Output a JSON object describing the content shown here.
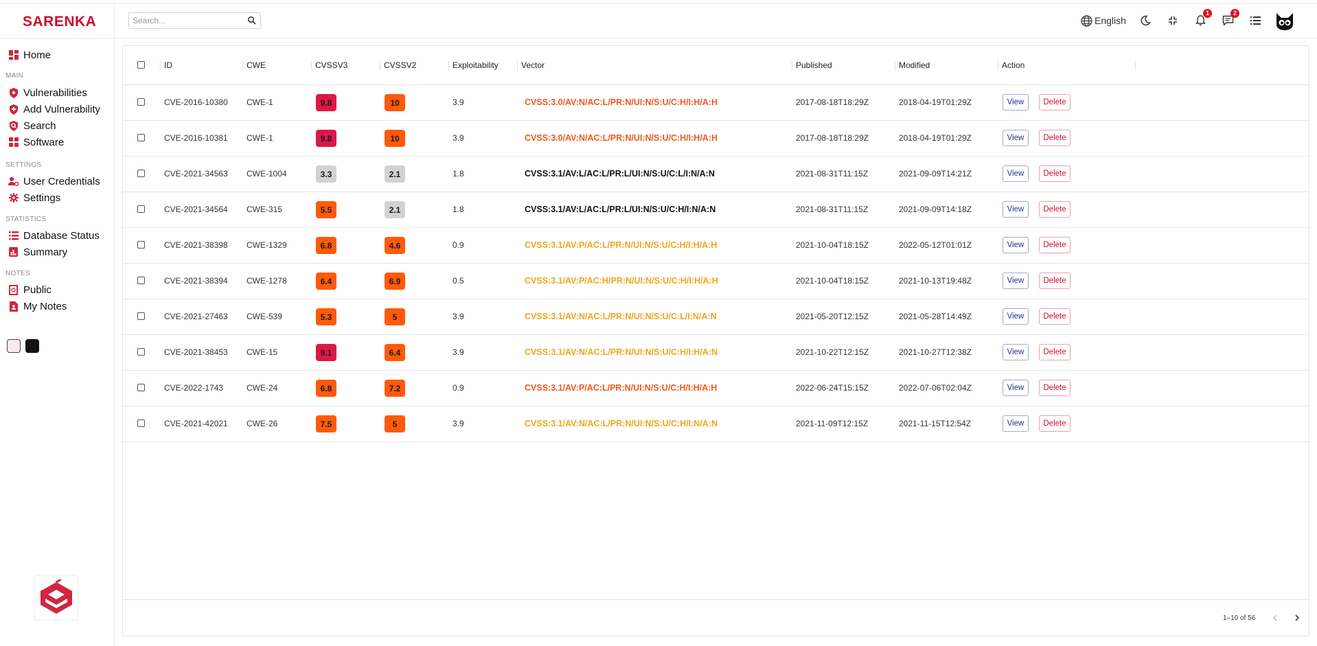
{
  "app": {
    "brand": "SARENKA"
  },
  "sidebar": {
    "home": "Home",
    "sections": {
      "main": "MAIN",
      "settings": "SETTINGS",
      "statistics": "STATISTICS",
      "notes": "NOTES"
    },
    "main_items": [
      "Vulnerabilities",
      "Add Vulnerability",
      "Search",
      "Software"
    ],
    "settings_items": [
      "User Credentials",
      "Settings"
    ],
    "statistics_items": [
      "Database Status",
      "Summary"
    ],
    "notes_items": [
      "Public",
      "My Notes"
    ],
    "theme_swatches": [
      "#f8e9ec",
      "#111111"
    ]
  },
  "header": {
    "search_placeholder": "Search...",
    "language": "English",
    "notifications_count": "1",
    "messages_count": "2"
  },
  "table": {
    "columns": [
      "ID",
      "CWE",
      "CVSSV3",
      "CVSSV2",
      "Exploitability",
      "Vector",
      "Published",
      "Modified",
      "Action"
    ],
    "view_label": "View",
    "delete_label": "Delete",
    "rows": [
      {
        "id": "CVE-2016-10380",
        "cwe": "CWE-1",
        "cvss3": "9.8",
        "cvss3_color": "#dc1848",
        "cvss2": "10",
        "cvss2_color": "#ff5a0a",
        "exploitability": "3.9",
        "vector": "CVSS:3.0/AV:N/AC:L/PR:N/UI:N/S:U/C:H/I:H/A:H",
        "vector_color": "#f0581f",
        "published": "2017-08-18T18:29Z",
        "modified": "2018-04-19T01:29Z"
      },
      {
        "id": "CVE-2016-10381",
        "cwe": "CWE-1",
        "cvss3": "9.8",
        "cvss3_color": "#dc1848",
        "cvss2": "10",
        "cvss2_color": "#ff5a0a",
        "exploitability": "3.9",
        "vector": "CVSS:3.0/AV:N/AC:L/PR:N/UI:N/S:U/C:H/I:H/A:H",
        "vector_color": "#f0581f",
        "published": "2017-08-18T18:29Z",
        "modified": "2018-04-19T01:29Z"
      },
      {
        "id": "CVE-2021-34563",
        "cwe": "CWE-1004",
        "cvss3": "3.3",
        "cvss3_color": "#d2d2d2",
        "cvss2": "2.1",
        "cvss2_color": "#d2d2d2",
        "exploitability": "1.8",
        "vector": "CVSS:3.1/AV:L/AC:L/PR:L/UI:N/S:U/C:L/I:N/A:N",
        "vector_color": "#111111",
        "published": "2021-08-31T11:15Z",
        "modified": "2021-09-09T14:21Z"
      },
      {
        "id": "CVE-2021-34564",
        "cwe": "CWE-315",
        "cvss3": "5.5",
        "cvss3_color": "#ff5a0a",
        "cvss2": "2.1",
        "cvss2_color": "#d2d2d2",
        "exploitability": "1.8",
        "vector": "CVSS:3.1/AV:L/AC:L/PR:L/UI:N/S:U/C:H/I:N/A:N",
        "vector_color": "#111111",
        "published": "2021-08-31T11:15Z",
        "modified": "2021-09-09T14:18Z"
      },
      {
        "id": "CVE-2021-38398",
        "cwe": "CWE-1329",
        "cvss3": "6.8",
        "cvss3_color": "#ff5a0a",
        "cvss2": "4.6",
        "cvss2_color": "#ff5a0a",
        "exploitability": "0.9",
        "vector": "CVSS:3.1/AV:P/AC:L/PR:N/UI:N/S:U/C:H/I:H/A:H",
        "vector_color": "#f0a51c",
        "published": "2021-10-04T18:15Z",
        "modified": "2022-05-12T01:01Z"
      },
      {
        "id": "CVE-2021-38394",
        "cwe": "CWE-1278",
        "cvss3": "6.4",
        "cvss3_color": "#ff5a0a",
        "cvss2": "6.9",
        "cvss2_color": "#ff5a0a",
        "exploitability": "0.5",
        "vector": "CVSS:3.1/AV:P/AC:H/PR:N/UI:N/S:U/C:H/I:H/A:H",
        "vector_color": "#f0a51c",
        "published": "2021-10-04T18:15Z",
        "modified": "2021-10-13T19:48Z"
      },
      {
        "id": "CVE-2021-27463",
        "cwe": "CWE-539",
        "cvss3": "5.3",
        "cvss3_color": "#ff5a0a",
        "cvss2": "5",
        "cvss2_color": "#ff5a0a",
        "exploitability": "3.9",
        "vector": "CVSS:3.1/AV:N/AC:L/PR:N/UI:N/S:U/C:L/I:N/A:N",
        "vector_color": "#f0a51c",
        "published": "2021-05-20T12:15Z",
        "modified": "2021-05-28T14:49Z"
      },
      {
        "id": "CVE-2021-38453",
        "cwe": "CWE-15",
        "cvss3": "9.1",
        "cvss3_color": "#dc1848",
        "cvss2": "6.4",
        "cvss2_color": "#ff5a0a",
        "exploitability": "3.9",
        "vector": "CVSS:3.1/AV:N/AC:L/PR:N/UI:N/S:U/C:H/I:H/A:N",
        "vector_color": "#f0a51c",
        "published": "2021-10-22T12:15Z",
        "modified": "2021-10-27T12:38Z"
      },
      {
        "id": "CVE-2022-1743",
        "cwe": "CWE-24",
        "cvss3": "6.8",
        "cvss3_color": "#ff5a0a",
        "cvss2": "7.2",
        "cvss2_color": "#ff5a0a",
        "exploitability": "0.9",
        "vector": "CVSS:3.1/AV:P/AC:L/PR:N/UI:N/S:U/C:H/I:H/A:H",
        "vector_color": "#f0581f",
        "published": "2022-06-24T15:15Z",
        "modified": "2022-07-06T02:04Z"
      },
      {
        "id": "CVE-2021-42021",
        "cwe": "CWE-26",
        "cvss3": "7.5",
        "cvss3_color": "#ff5a0a",
        "cvss2": "5",
        "cvss2_color": "#ff5a0a",
        "exploitability": "3.9",
        "vector": "CVSS:3.1/AV:N/AC:L/PR:N/UI:N/S:U/C:H/I:N/A:N",
        "vector_color": "#f0a51c",
        "published": "2021-11-09T12:15Z",
        "modified": "2021-11-15T12:54Z"
      }
    ]
  },
  "pagination": {
    "text": "1–10 of 56"
  },
  "colors": {
    "brand": "#c8102e",
    "icon": "#d0263f"
  }
}
